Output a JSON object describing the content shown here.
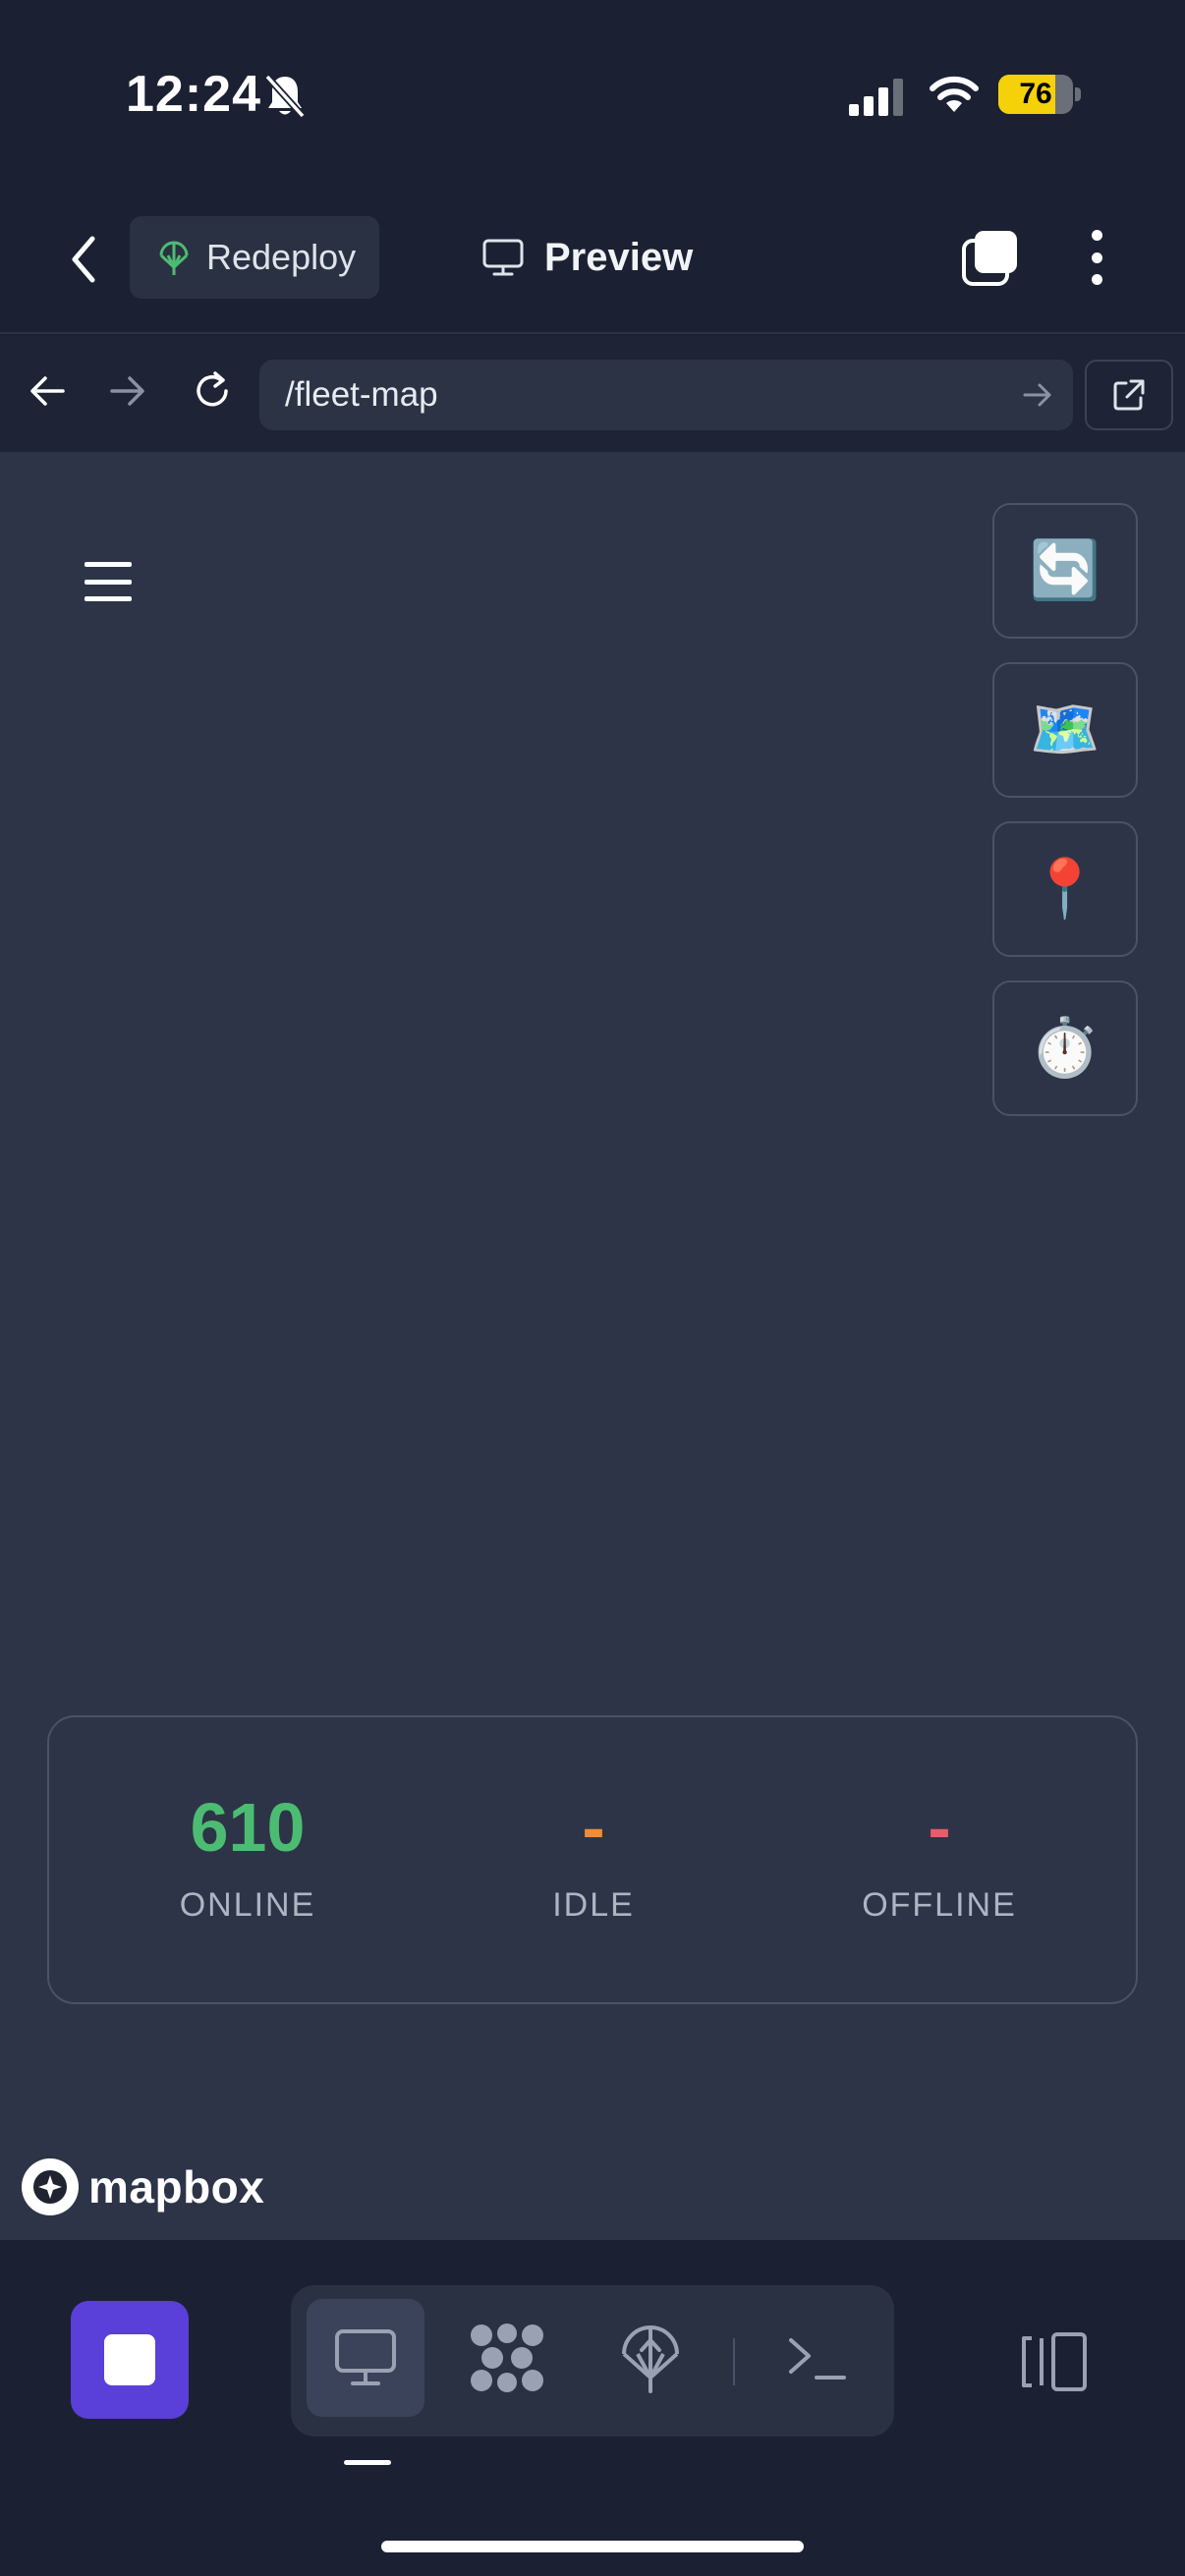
{
  "status_bar": {
    "time": "12:24",
    "battery_level": "76",
    "icons": [
      "bell-slash-icon",
      "signal-icon",
      "wifi-icon",
      "battery-icon"
    ]
  },
  "header": {
    "redeploy_label": "Redeploy",
    "preview_label": "Preview",
    "icons": [
      "chevron-left-icon",
      "deploy-icon",
      "monitor-icon",
      "windows-icon",
      "more-vertical-icon"
    ]
  },
  "browser": {
    "url": "/fleet-map",
    "icons": [
      "arrow-left-icon",
      "arrow-right-icon",
      "reload-icon",
      "go-arrow-icon",
      "external-link-icon"
    ]
  },
  "map": {
    "controls": [
      {
        "emoji": "🔄",
        "icon": "refresh-icon"
      },
      {
        "emoji": "🗺️",
        "icon": "map-icon"
      },
      {
        "emoji": "📍",
        "icon": "pin-icon"
      },
      {
        "emoji": "⏱️",
        "icon": "stopwatch-icon"
      }
    ],
    "attribution": "mapbox"
  },
  "stats": [
    {
      "value": "610",
      "label": "ONLINE",
      "color": "#4cbc72"
    },
    {
      "value": "-",
      "label": "IDLE",
      "color": "#f08c3a"
    },
    {
      "value": "-",
      "label": "OFFLINE",
      "color": "#e85d6a"
    }
  ],
  "bottom_bar": {
    "tools": [
      "monitor-icon",
      "modules-icon",
      "deploy-icon",
      "terminal-icon"
    ],
    "icons": [
      "stop-icon",
      "side-panel-icon"
    ]
  }
}
